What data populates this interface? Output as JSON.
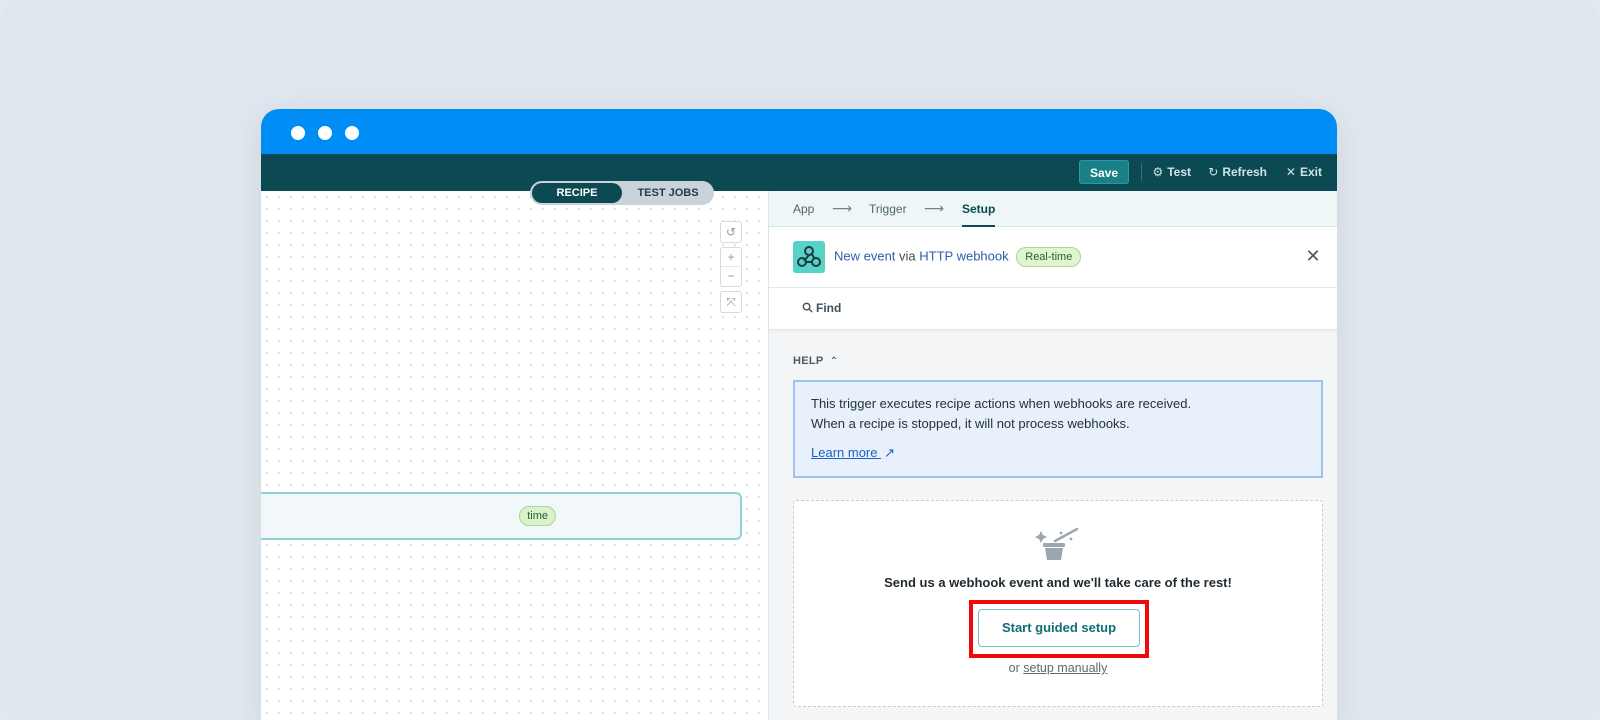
{
  "window": {
    "controls": [
      "dot",
      "dot",
      "dot"
    ]
  },
  "topnav": {
    "save_label": "Save",
    "test_label": "Test",
    "refresh_label": "Refresh",
    "exit_label": "Exit"
  },
  "canvas": {
    "toggle": {
      "recipe_label": "RECIPE",
      "test_jobs_label": "TEST JOBS",
      "selected": "RECIPE"
    },
    "trigger_badge": "time",
    "zoom": {
      "reset_icon": "↺",
      "zoom_in": "+",
      "zoom_out": "−",
      "fit_icon": "⤧"
    }
  },
  "panel": {
    "steps": {
      "app": "App",
      "trigger": "Trigger",
      "setup": "Setup",
      "arrow": "⟶"
    },
    "event": {
      "part1": "New event",
      "part2": " via ",
      "part3": "HTTP webhook",
      "badge": "Real-time",
      "close": "✕"
    },
    "find_label": "Find",
    "help": {
      "title": "HELP",
      "line1": "This trigger executes recipe actions when webhooks are received.",
      "line2": "When a recipe is stopped, it will not process webhooks.",
      "learn_more": "Learn more"
    },
    "setup": {
      "message": "Send us a webhook event and we'll take care of the rest!",
      "guided_button": "Start guided setup",
      "or_text": "or ",
      "manual_link": "setup manually"
    }
  },
  "colors": {
    "titlebar": "#008cf5",
    "topnav": "#0b4a52",
    "highlight": "#ee0a0a",
    "accent_teal": "#116e75"
  }
}
